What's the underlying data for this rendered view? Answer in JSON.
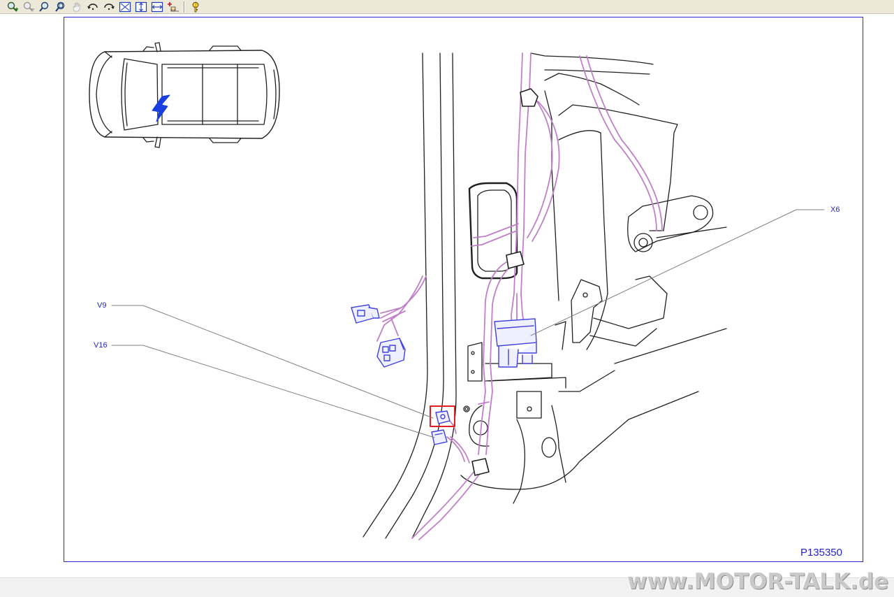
{
  "toolbar": {
    "buttons": [
      {
        "icon": "zoom-in-icon"
      },
      {
        "icon": "zoom-out-icon"
      },
      {
        "icon": "zoom-icon"
      },
      {
        "icon": "zoom-window-icon"
      },
      {
        "icon": "pan-hand-icon"
      },
      {
        "icon": "rotate-left-icon"
      },
      {
        "icon": "rotate-right-icon"
      },
      {
        "icon": "fit-page-icon"
      },
      {
        "icon": "fit-height-icon"
      },
      {
        "icon": "fit-width-icon"
      },
      {
        "icon": "measure-icon"
      },
      {
        "icon": "help-key-icon"
      }
    ]
  },
  "diagram": {
    "callouts": {
      "x6": "X6",
      "v9": "V9",
      "v16": "V16"
    },
    "reference_id": "P135350"
  },
  "watermark": "www.MOTOR-TALK.de",
  "colors": {
    "frame_border": "#2b2bd0",
    "harness": "#c080c8",
    "connector": "#4040e0",
    "highlight": "#e02020",
    "arrow": "#1a3fe0"
  }
}
